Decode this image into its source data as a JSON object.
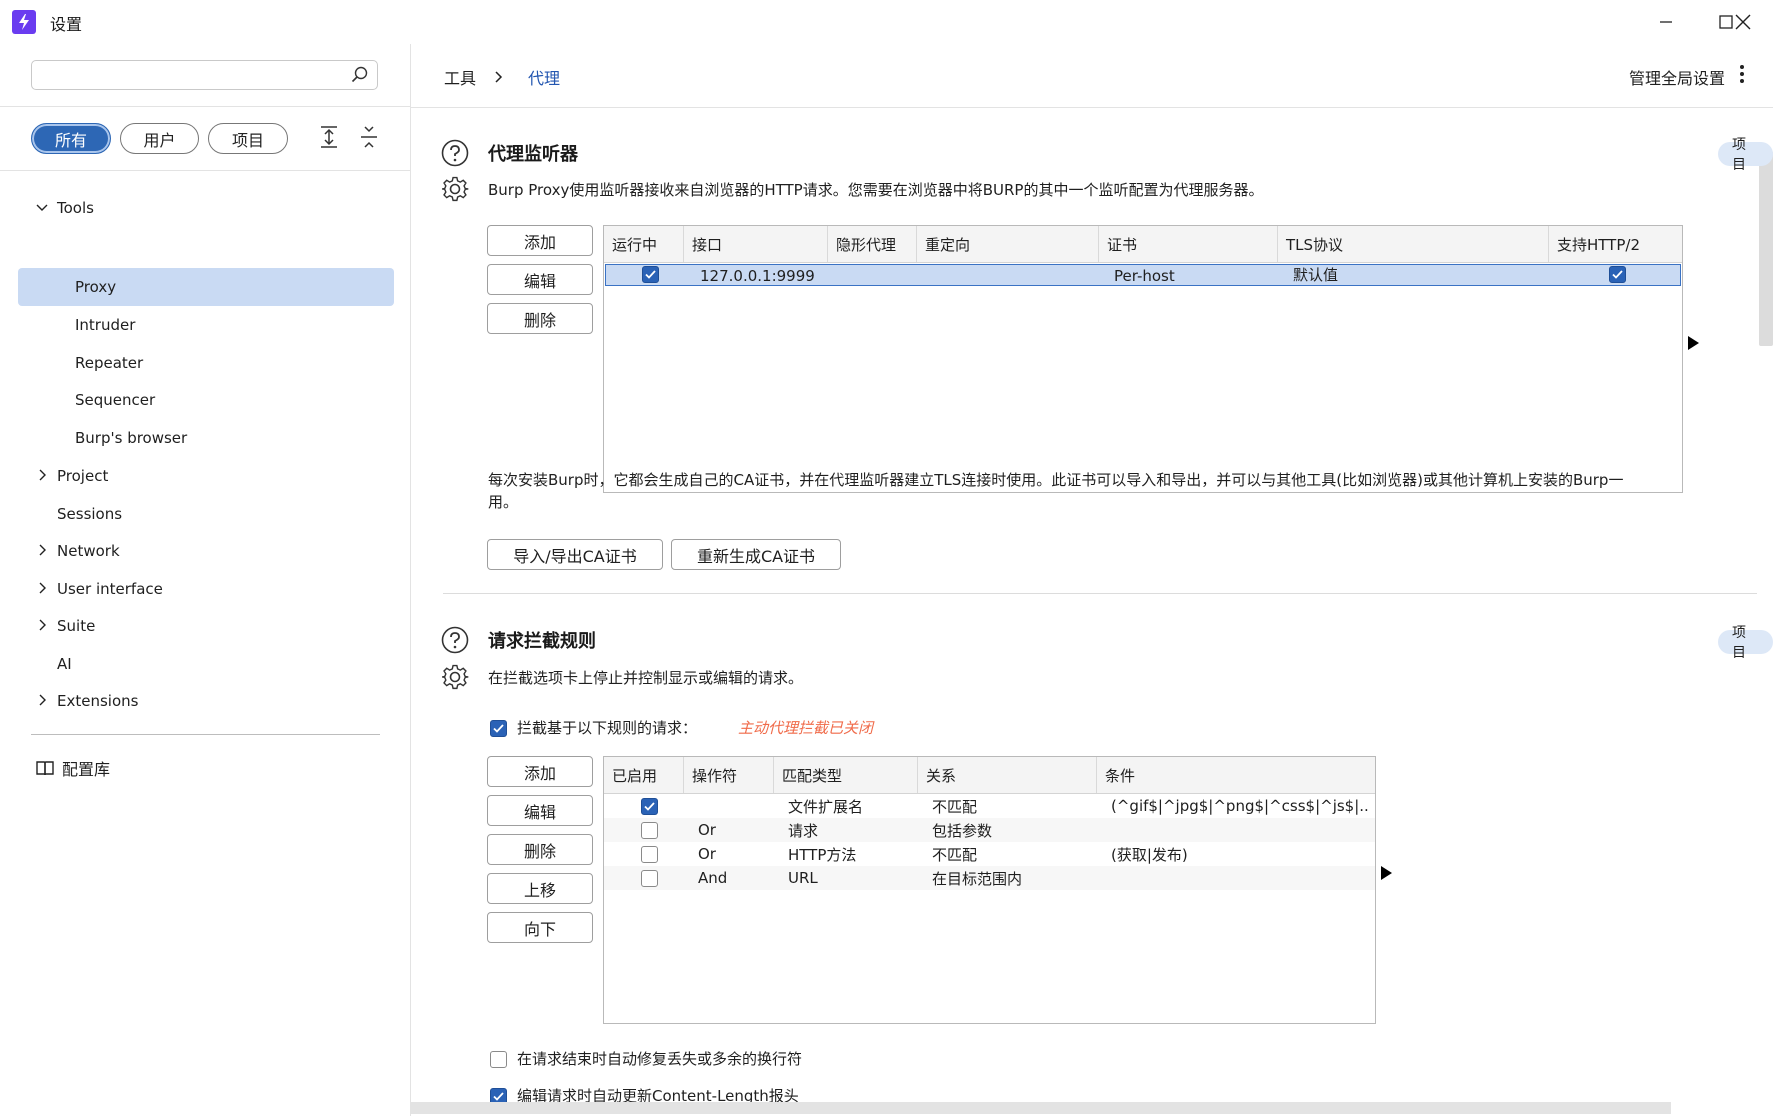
{
  "window": {
    "title": "设置",
    "accent": "#6a3cf0"
  },
  "sidebar": {
    "search": {
      "value": "",
      "placeholder": ""
    },
    "filters": [
      {
        "label": "所有",
        "active": true
      },
      {
        "label": "用户",
        "active": false
      },
      {
        "label": "项目",
        "active": false
      }
    ],
    "tree": [
      {
        "label": "Tools",
        "expanded": true,
        "children": [
          {
            "label": "Proxy",
            "selected": true
          },
          {
            "label": "Intruder"
          },
          {
            "label": "Repeater"
          },
          {
            "label": "Sequencer"
          },
          {
            "label": "Burp's browser"
          }
        ]
      },
      {
        "label": "Project",
        "expandable": true
      },
      {
        "label": "Sessions",
        "expandable": false
      },
      {
        "label": "Network",
        "expandable": true
      },
      {
        "label": "User interface",
        "expandable": true
      },
      {
        "label": "Suite",
        "expandable": true
      },
      {
        "label": "AI",
        "expandable": false
      },
      {
        "label": "Extensions",
        "expandable": true
      }
    ],
    "library_label": "配置库"
  },
  "topbar": {
    "breadcrumb": [
      "工具",
      "代理"
    ],
    "global_settings": "管理全局设置"
  },
  "listeners": {
    "title": "代理监听器",
    "tag": "项目",
    "description": "Burp Proxy使用监听器接收来自浏览器的HTTP请求。您需要在浏览器中将BURP的其中一个监听配置为代理服务器。",
    "buttons": [
      "添加",
      "编辑",
      "删除"
    ],
    "columns": [
      "运行中",
      "接口",
      "隐形代理",
      "重定向",
      "证书",
      "TLS协议",
      "支持HTTP/2"
    ],
    "rows": [
      {
        "running": true,
        "interface": "127.0.0.1:9999",
        "invisible": "",
        "redirect": "",
        "cert": "Per-host",
        "tls": "默认值",
        "http2": true
      }
    ],
    "ca_note": "每次安装Burp时，它都会生成自己的CA证书，并在代理监听器建立TLS连接时使用。此证书可以导入和导出，并可以与其他工具(比如浏览器)或其他计算机上安装的Burp一起使用。",
    "ca_note_line1": "每次安装Burp时，它都会生成自己的CA证书，并在代理监听器建立TLS连接时使用。此证书可以导入和导出，并可以与其他工具(比如浏览器)或其他计算机上安装的Burp一",
    "ca_note_line2": "用。",
    "ca_buttons": [
      "导入/导出CA证书",
      "重新生成CA证书"
    ]
  },
  "intercept": {
    "title": "请求拦截规则",
    "tag": "项目",
    "description": "在拦截选项卡上停止并控制显示或编辑的请求。",
    "enable_label": "拦截基于以下规则的请求：",
    "enable_checked": true,
    "warning": "主动代理拦截已关闭",
    "warning_color": "#f06b4a",
    "buttons": [
      "添加",
      "编辑",
      "删除",
      "上移",
      "向下"
    ],
    "columns": [
      "已启用",
      "操作符",
      "匹配类型",
      "关系",
      "条件"
    ],
    "rows": [
      {
        "enabled": true,
        "op": "",
        "match": "文件扩展名",
        "rel": "不匹配",
        "cond": "(^gif$|^jpg$|^png$|^css$|^js$|..."
      },
      {
        "enabled": false,
        "op": "Or",
        "match": "请求",
        "rel": "包括参数",
        "cond": ""
      },
      {
        "enabled": false,
        "op": "Or",
        "match": "HTTP方法",
        "rel": "不匹配",
        "cond": "(获取|发布)"
      },
      {
        "enabled": false,
        "op": "And",
        "match": "URL",
        "rel": "在目标范围内",
        "cond": ""
      }
    ],
    "options": [
      {
        "label": "在请求结束时自动修复丢失或多余的换行符",
        "checked": false
      },
      {
        "label": "编辑请求时自动更新Content-Length报头",
        "checked": true
      }
    ]
  }
}
